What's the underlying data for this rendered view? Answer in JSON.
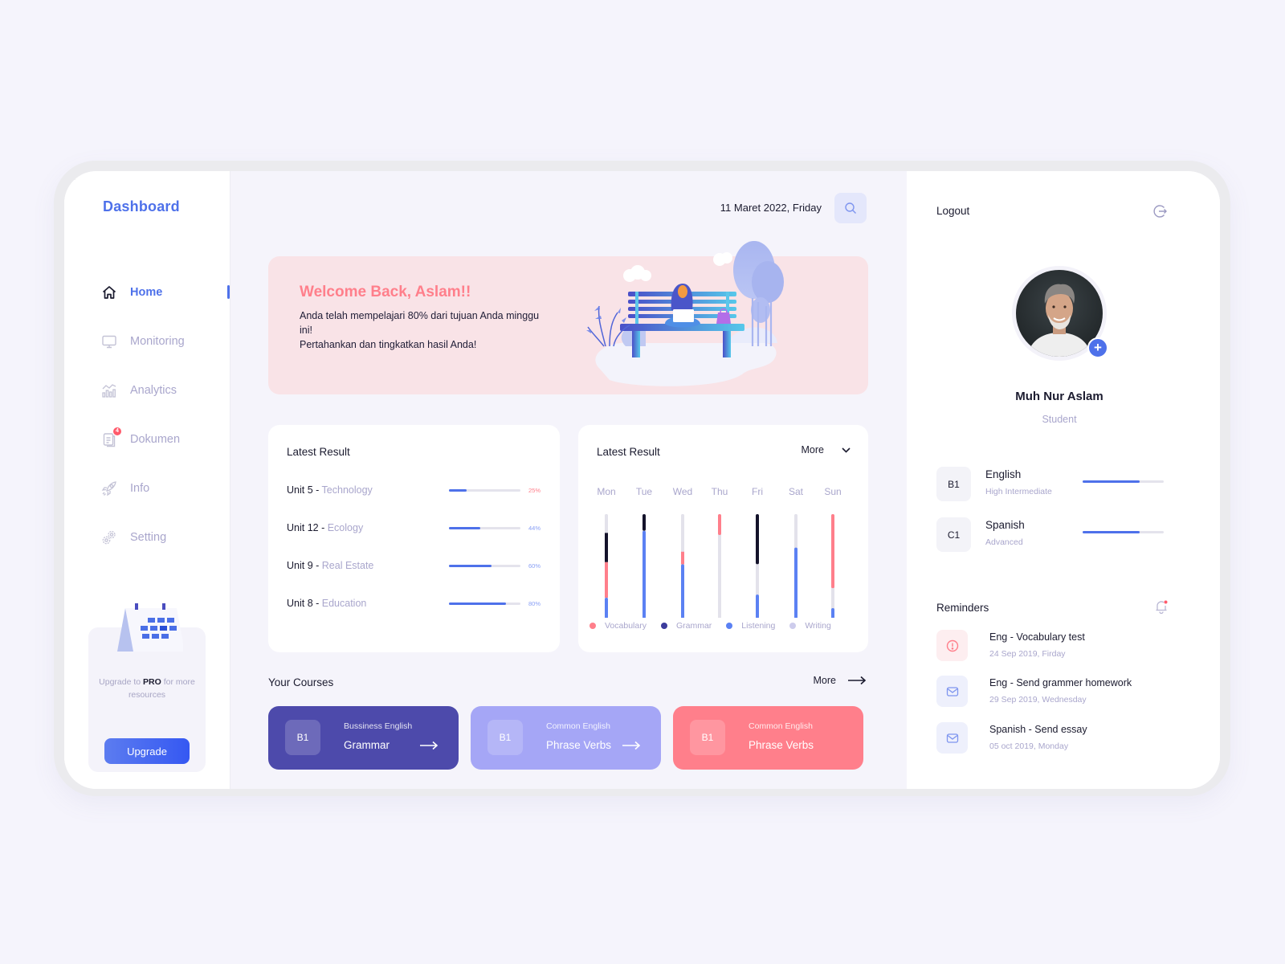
{
  "sidebar": {
    "brand": "Dashboard",
    "items": [
      {
        "label": "Home",
        "icon": "home-icon",
        "active": true
      },
      {
        "label": "Monitoring",
        "icon": "monitor-icon"
      },
      {
        "label": "Analytics",
        "icon": "analytics-icon"
      },
      {
        "label": "Dokumen",
        "icon": "document-icon",
        "badge": "4"
      },
      {
        "label": "Info",
        "icon": "rocket-icon"
      },
      {
        "label": "Setting",
        "icon": "gear-icon"
      }
    ],
    "promo": {
      "text_before": "Upgrade to ",
      "text_bold": "PRO",
      "text_after": " for more resources",
      "button": "Upgrade"
    }
  },
  "header": {
    "date": "11 Maret 2022, Friday",
    "search_icon": "search-icon"
  },
  "hero": {
    "title": "Welcome Back, Aslam!!",
    "line1": "Anda telah mempelajari 80% dari tujuan Anda minggu ini!",
    "line2": "Pertahankan dan tingkatkan hasil Anda!"
  },
  "latest_result": {
    "title": "Latest Result",
    "rows": [
      {
        "unit": "Unit 5 - ",
        "topic": "Technology",
        "percent": 25,
        "label": "25%"
      },
      {
        "unit": "Unit 12 - ",
        "topic": "Ecology",
        "percent": 44,
        "label": "44%"
      },
      {
        "unit": "Unit 9 - ",
        "topic": "Real Estate",
        "percent": 60,
        "label": "60%"
      },
      {
        "unit": "Unit 8 - ",
        "topic": "Education",
        "percent": 80,
        "label": "80%"
      }
    ]
  },
  "weekly_chart": {
    "title": "Latest Result",
    "more_label": "More"
  },
  "chart_data": {
    "type": "bar",
    "stacked": true,
    "orientation": "vertical",
    "title": "Latest Result",
    "categories": [
      "Mon",
      "Tue",
      "Wed",
      "Thu",
      "Fri",
      "Sat",
      "Sun"
    ],
    "legend": [
      "Vocabulary",
      "Grammar",
      "Listening",
      "Writing"
    ],
    "legend_placement": "bottom",
    "colors": {
      "Vocabulary": "#ff7f8b",
      "Grammar": "#14132b",
      "Listening": "#5b81f3",
      "Writing": "#e3e2eb"
    },
    "note": "Each bar is 100% total; segments listed top-to-bottom as percent of bar height",
    "segments": [
      [
        {
          "s": "Writing",
          "v": 18
        },
        {
          "s": "Grammar",
          "v": 28
        },
        {
          "s": "Vocabulary",
          "v": 34
        },
        {
          "s": "Listening",
          "v": 20
        }
      ],
      [
        {
          "s": "Grammar",
          "v": 16
        },
        {
          "s": "Listening",
          "v": 84
        }
      ],
      [
        {
          "s": "Writing",
          "v": 36
        },
        {
          "s": "Vocabulary",
          "v": 12
        },
        {
          "s": "Listening",
          "v": 52
        }
      ],
      [
        {
          "s": "Vocabulary",
          "v": 20
        },
        {
          "s": "Writing",
          "v": 80
        }
      ],
      [
        {
          "s": "Grammar",
          "v": 48
        },
        {
          "s": "Writing",
          "v": 29
        },
        {
          "s": "Listening",
          "v": 23
        }
      ],
      [
        {
          "s": "Writing",
          "v": 32
        },
        {
          "s": "Listening",
          "v": 68
        }
      ],
      [
        {
          "s": "Vocabulary",
          "v": 71
        },
        {
          "s": "Writing",
          "v": 19
        },
        {
          "s": "Listening",
          "v": 10
        }
      ]
    ],
    "grid": false
  },
  "courses": {
    "title": "Your Courses",
    "more_label": "More",
    "items": [
      {
        "level": "B1",
        "category": "Bussiness English",
        "name": "Grammar",
        "color": "#4d4aab",
        "arrow": true
      },
      {
        "level": "B1",
        "category": "Common English",
        "name": "Phrase Verbs",
        "color": "#a5a6f6",
        "arrow": true
      },
      {
        "level": "B1",
        "category": "Common English",
        "name": "Phrase Verbs",
        "color": "#ff7f8b",
        "arrow": false
      }
    ]
  },
  "profile": {
    "logout_label": "Logout",
    "name": "Muh Nur Aslam",
    "role": "Student"
  },
  "languages": [
    {
      "level": "B1",
      "name": "English",
      "sub": "High Intermediate",
      "progress": 70
    },
    {
      "level": "C1",
      "name": "Spanish",
      "sub": "Advanced",
      "progress": 70
    }
  ],
  "reminders": {
    "title": "Reminders",
    "items": [
      {
        "title": "Eng - Vocabulary test",
        "date": "24 Sep 2019, Firday",
        "icon": "alert-icon",
        "bg": "#fdeef0"
      },
      {
        "title": "Eng - Send grammer homework",
        "date": "29 Sep 2019, Wednesday",
        "icon": "mail-icon",
        "bg": "#eef0fc"
      },
      {
        "title": "Spanish - Send essay",
        "date": "05 oct 2019, Monday",
        "icon": "mail-icon",
        "bg": "#eef0fc"
      }
    ]
  },
  "colors": {
    "accent": "#4e71ea",
    "pink": "#ff7f8b",
    "muted": "#a9a6cc",
    "background": "#f5f4fb"
  }
}
